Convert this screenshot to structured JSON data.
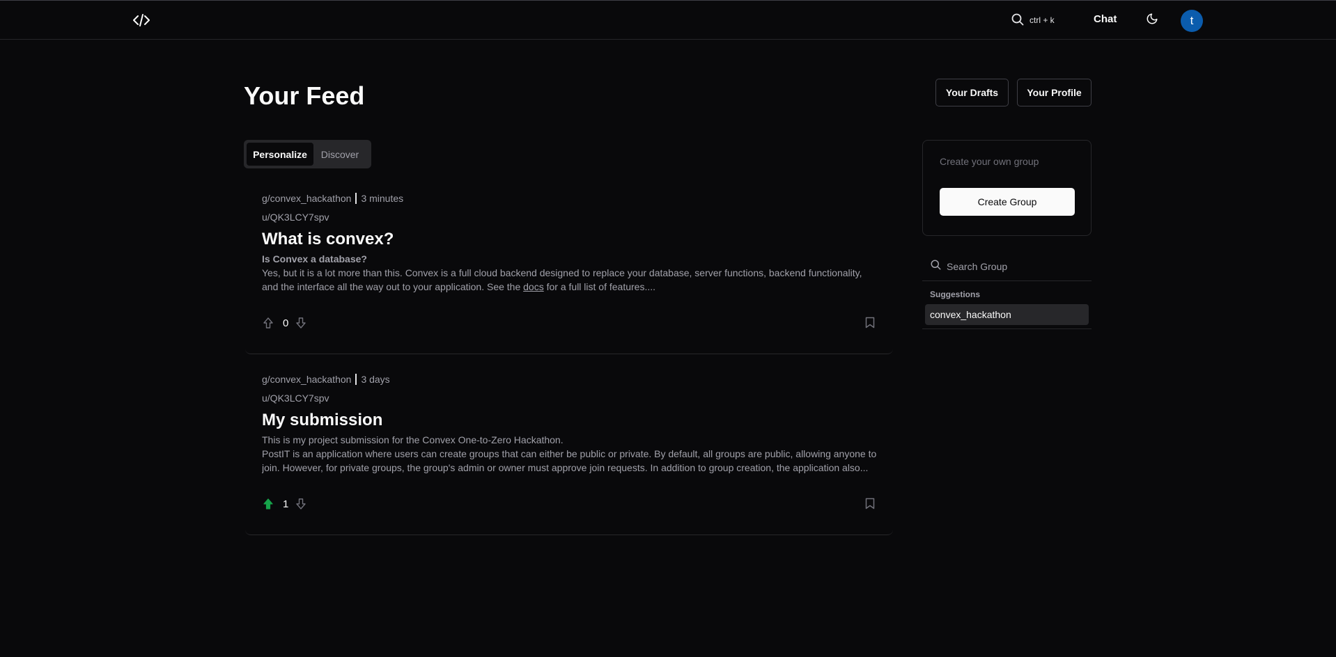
{
  "nav": {
    "search_shortcut": "ctrl + k",
    "chat_label": "Chat",
    "avatar_initial": "t"
  },
  "header": {
    "title": "Your Feed",
    "drafts_label": "Your Drafts",
    "profile_label": "Your Profile"
  },
  "tabs": [
    {
      "label": "Personalize",
      "active": true
    },
    {
      "label": "Discover",
      "active": false
    }
  ],
  "posts": [
    {
      "group": "g/convex_hackathon",
      "time": "3 minutes",
      "author": "u/QK3LCY7spv",
      "title": "What is convex?",
      "subtitle": "Is Convex a database?",
      "body_before_link": "Yes, but it is a lot more than this. Convex is a full cloud backend designed to replace your database, server functions, backend functionality, and the interface all the way out to your application. See the ",
      "link_text": "docs",
      "body_after_link": " for a full list of features....",
      "votes": "0",
      "upvoted": false
    },
    {
      "group": "g/convex_hackathon",
      "time": "3 days",
      "author": "u/QK3LCY7spv",
      "title": "My submission",
      "line1": "This is my project submission for the Convex One-to-Zero Hackathon.",
      "line2": "PostIT is an application where users can create groups that can either be public or private. By default, all groups are public, allowing anyone to join. However, for private groups, the group's admin or owner must approve join requests. In addition to group creation, the application also...",
      "votes": "1",
      "upvoted": true
    }
  ],
  "sidebar": {
    "create_prompt": "Create your own group",
    "create_button": "Create Group",
    "search_placeholder": "Search Group",
    "suggestions_heading": "Suggestions",
    "suggestions": [
      "convex_hackathon"
    ]
  },
  "colors": {
    "background": "#09090b",
    "border": "#27272a",
    "muted_text": "#a1a1aa",
    "avatar": "#0b5cad",
    "upvote_active": "#16a34a"
  },
  "icons": [
    "code-logo-icon",
    "search-icon",
    "moon-icon",
    "arrow-up-icon",
    "arrow-down-icon",
    "bookmark-icon"
  ]
}
